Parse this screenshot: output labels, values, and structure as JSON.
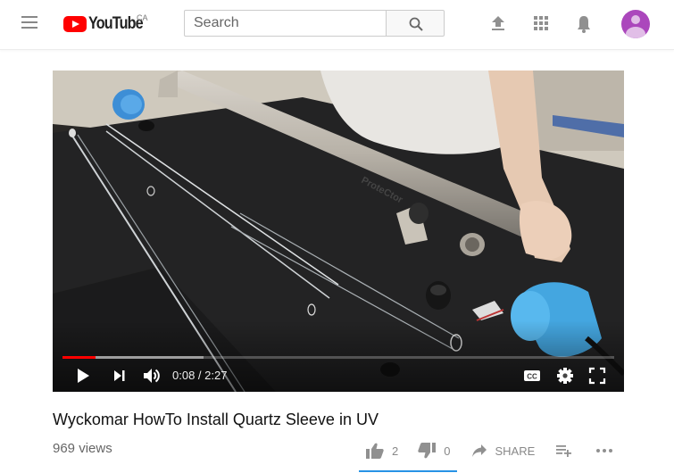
{
  "masthead": {
    "menu_icon": "hamburger-menu-icon",
    "logo_text": "YouTube",
    "region": "CA",
    "search": {
      "placeholder": "Search",
      "value": ""
    },
    "icons": [
      "upload-icon",
      "apps-grid-icon",
      "notifications-bell-icon",
      "avatar"
    ]
  },
  "player": {
    "current_time": "0:08",
    "duration": "2:27",
    "time_display": "0:08 / 2:27",
    "progress_played_fraction": 0.06,
    "progress_buffered_fraction": 0.255,
    "colors": {
      "played": "#ff0000"
    },
    "overlay_text": "ProteCtor",
    "controls": [
      "play-icon",
      "next-icon",
      "volume-icon",
      "captions-icon",
      "settings-gear-icon",
      "fullscreen-icon"
    ],
    "cc_label": "CC"
  },
  "video": {
    "title": "Wyckomar HowTo Install Quartz Sleeve in UV",
    "views": "969 views",
    "likes": "2",
    "dislikes": "0",
    "share_label": "SHARE",
    "like_bar_color": "#2793e6"
  }
}
